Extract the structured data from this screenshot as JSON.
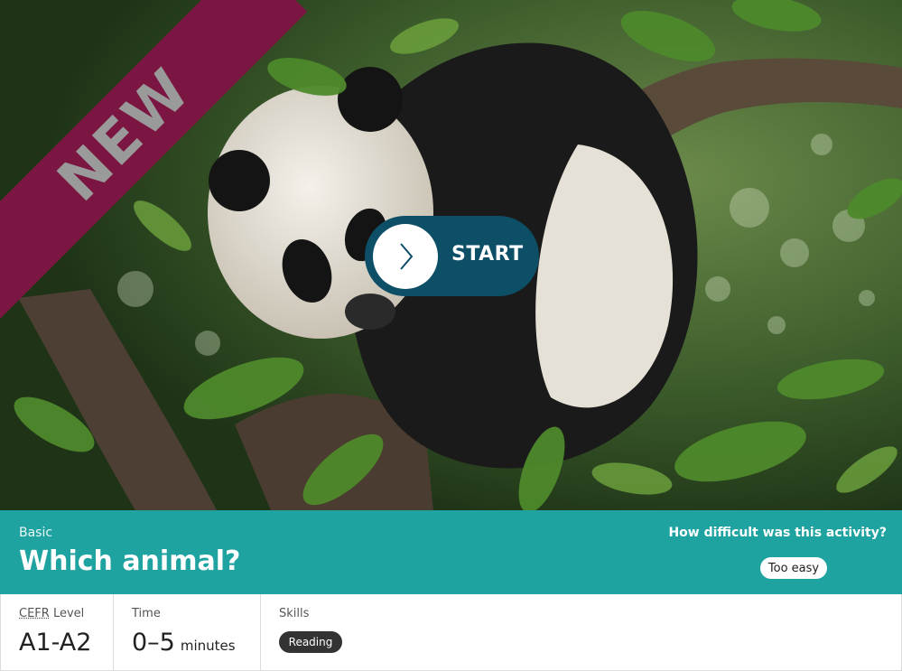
{
  "hero": {
    "badge": "NEW",
    "start_label": "START",
    "image_subject": "panda-in-tree"
  },
  "activity": {
    "level": "Basic",
    "title": "Which animal?",
    "difficulty_question": "How difficult was this activity?",
    "difficulty_rating": "Too easy"
  },
  "meta": {
    "cefr_abbr": "CEFR",
    "cefr_label": "Level",
    "cefr_value": "A1-A2",
    "time_label": "Time",
    "time_value": "0–5",
    "time_unit": "minutes",
    "skills_label": "Skills",
    "skills": [
      "Reading"
    ]
  },
  "colors": {
    "ribbon": "#7b1642",
    "start_button": "#0e4f68",
    "info_bar": "#1fa3a0",
    "skill_pill": "#333333"
  }
}
